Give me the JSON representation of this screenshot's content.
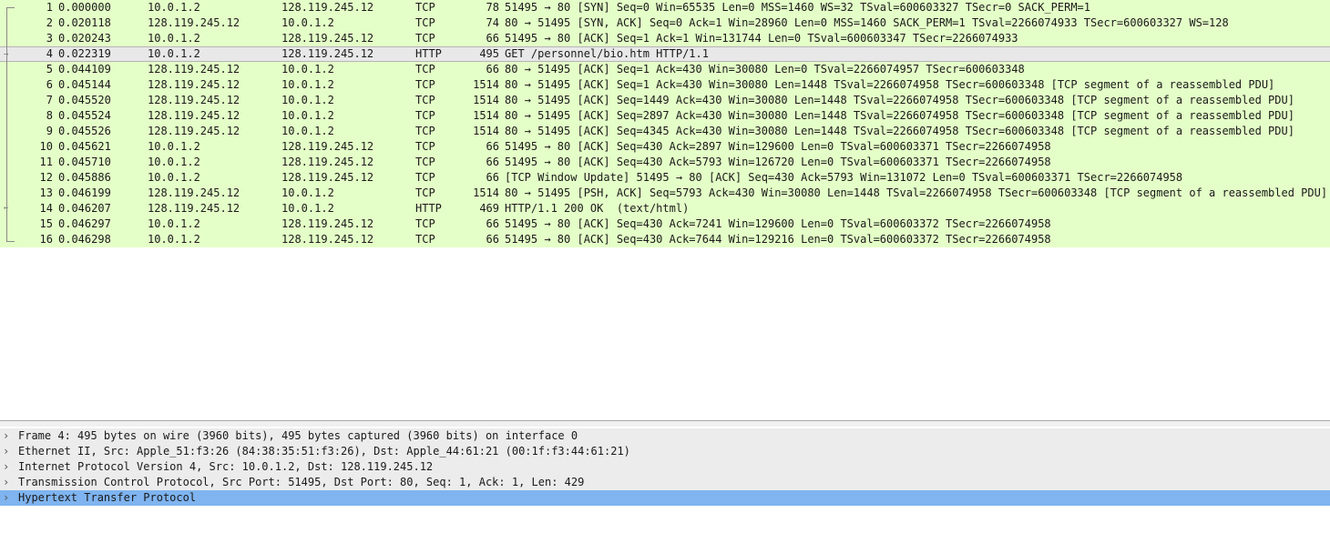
{
  "packets": [
    {
      "no": "1",
      "time": "0.000000",
      "src": "10.0.1.2",
      "dst": "128.119.245.12",
      "proto": "TCP",
      "len": "78",
      "info": "51495 → 80 [SYN] Seq=0 Win=65535 Len=0 MSS=1460 WS=32 TSval=600603327 TSecr=0 SACK_PERM=1"
    },
    {
      "no": "2",
      "time": "0.020118",
      "src": "128.119.245.12",
      "dst": "10.0.1.2",
      "proto": "TCP",
      "len": "74",
      "info": "80 → 51495 [SYN, ACK] Seq=0 Ack=1 Win=28960 Len=0 MSS=1460 SACK_PERM=1 TSval=2266074933 TSecr=600603327 WS=128"
    },
    {
      "no": "3",
      "time": "0.020243",
      "src": "10.0.1.2",
      "dst": "128.119.245.12",
      "proto": "TCP",
      "len": "66",
      "info": "51495 → 80 [ACK] Seq=1 Ack=1 Win=131744 Len=0 TSval=600603347 TSecr=2266074933"
    },
    {
      "no": "4",
      "time": "0.022319",
      "src": "10.0.1.2",
      "dst": "128.119.245.12",
      "proto": "HTTP",
      "len": "495",
      "info": "GET /personnel/bio.htm HTTP/1.1"
    },
    {
      "no": "5",
      "time": "0.044109",
      "src": "128.119.245.12",
      "dst": "10.0.1.2",
      "proto": "TCP",
      "len": "66",
      "info": "80 → 51495 [ACK] Seq=1 Ack=430 Win=30080 Len=0 TSval=2266074957 TSecr=600603348"
    },
    {
      "no": "6",
      "time": "0.045144",
      "src": "128.119.245.12",
      "dst": "10.0.1.2",
      "proto": "TCP",
      "len": "1514",
      "info": "80 → 51495 [ACK] Seq=1 Ack=430 Win=30080 Len=1448 TSval=2266074958 TSecr=600603348 [TCP segment of a reassembled PDU]"
    },
    {
      "no": "7",
      "time": "0.045520",
      "src": "128.119.245.12",
      "dst": "10.0.1.2",
      "proto": "TCP",
      "len": "1514",
      "info": "80 → 51495 [ACK] Seq=1449 Ack=430 Win=30080 Len=1448 TSval=2266074958 TSecr=600603348 [TCP segment of a reassembled PDU]"
    },
    {
      "no": "8",
      "time": "0.045524",
      "src": "128.119.245.12",
      "dst": "10.0.1.2",
      "proto": "TCP",
      "len": "1514",
      "info": "80 → 51495 [ACK] Seq=2897 Ack=430 Win=30080 Len=1448 TSval=2266074958 TSecr=600603348 [TCP segment of a reassembled PDU]"
    },
    {
      "no": "9",
      "time": "0.045526",
      "src": "128.119.245.12",
      "dst": "10.0.1.2",
      "proto": "TCP",
      "len": "1514",
      "info": "80 → 51495 [ACK] Seq=4345 Ack=430 Win=30080 Len=1448 TSval=2266074958 TSecr=600603348 [TCP segment of a reassembled PDU]"
    },
    {
      "no": "10",
      "time": "0.045621",
      "src": "10.0.1.2",
      "dst": "128.119.245.12",
      "proto": "TCP",
      "len": "66",
      "info": "51495 → 80 [ACK] Seq=430 Ack=2897 Win=129600 Len=0 TSval=600603371 TSecr=2266074958"
    },
    {
      "no": "11",
      "time": "0.045710",
      "src": "10.0.1.2",
      "dst": "128.119.245.12",
      "proto": "TCP",
      "len": "66",
      "info": "51495 → 80 [ACK] Seq=430 Ack=5793 Win=126720 Len=0 TSval=600603371 TSecr=2266074958"
    },
    {
      "no": "12",
      "time": "0.045886",
      "src": "10.0.1.2",
      "dst": "128.119.245.12",
      "proto": "TCP",
      "len": "66",
      "info": "[TCP Window Update] 51495 → 80 [ACK] Seq=430 Ack=5793 Win=131072 Len=0 TSval=600603371 TSecr=2266074958"
    },
    {
      "no": "13",
      "time": "0.046199",
      "src": "128.119.245.12",
      "dst": "10.0.1.2",
      "proto": "TCP",
      "len": "1514",
      "info": "80 → 51495 [PSH, ACK] Seq=5793 Ack=430 Win=30080 Len=1448 TSval=2266074958 TSecr=600603348 [TCP segment of a reassembled PDU]"
    },
    {
      "no": "14",
      "time": "0.046207",
      "src": "128.119.245.12",
      "dst": "10.0.1.2",
      "proto": "HTTP",
      "len": "469",
      "info": "HTTP/1.1 200 OK  (text/html)"
    },
    {
      "no": "15",
      "time": "0.046297",
      "src": "10.0.1.2",
      "dst": "128.119.245.12",
      "proto": "TCP",
      "len": "66",
      "info": "51495 → 80 [ACK] Seq=430 Ack=7241 Win=129600 Len=0 TSval=600603372 TSecr=2266074958"
    },
    {
      "no": "16",
      "time": "0.046298",
      "src": "10.0.1.2",
      "dst": "128.119.245.12",
      "proto": "TCP",
      "len": "66",
      "info": "51495 → 80 [ACK] Seq=430 Ack=7644 Win=129216 Len=0 TSval=600603372 TSecr=2266074958"
    }
  ],
  "selected_packet": "4",
  "details": [
    {
      "text": "Frame 4: 495 bytes on wire (3960 bits), 495 bytes captured (3960 bits) on interface 0",
      "selected": false
    },
    {
      "text": "Ethernet II, Src: Apple_51:f3:26 (84:38:35:51:f3:26), Dst: Apple_44:61:21 (00:1f:f3:44:61:21)",
      "selected": false
    },
    {
      "text": "Internet Protocol Version 4, Src: 10.0.1.2, Dst: 128.119.245.12",
      "selected": false
    },
    {
      "text": "Transmission Control Protocol, Src Port: 51495, Dst Port: 80, Seq: 1, Ack: 1, Len: 429",
      "selected": false
    },
    {
      "text": "Hypertext Transfer Protocol",
      "selected": true
    }
  ],
  "icons": {
    "expand": "chevron-right-icon",
    "request_marker": "arrow-right-icon",
    "response_marker": "arrow-left-icon"
  },
  "colors": {
    "tcp_row": "#e4ffc7",
    "selected_row": "#e8e8e8",
    "detail_selected": "#7fb4f0",
    "detail_row": "#ececec"
  }
}
